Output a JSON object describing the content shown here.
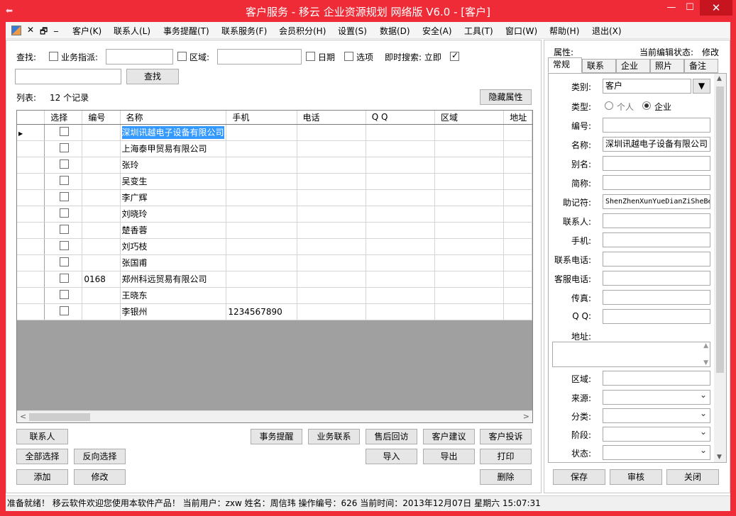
{
  "window": {
    "title": "客户服务 - 移云 企业资源规划 网络版 V6.0 - [客户]",
    "min_glyph": "—",
    "max_glyph": "☐",
    "close_glyph": "✕"
  },
  "menubar": {
    "items": [
      "客户(K)",
      "联系人(L)",
      "事务提醒(T)",
      "联系服务(F)",
      "会员积分(H)",
      "设置(S)",
      "数据(D)",
      "安全(A)",
      "工具(T)",
      "窗口(W)",
      "帮助(H)",
      "退出(X)"
    ],
    "mdi_close": "✕",
    "mdi_restore": "🗗",
    "mdi_min": "_"
  },
  "search": {
    "find_label": "查找:",
    "owner_label": "业务指派:",
    "region_label": "区域:",
    "date_label": "日期",
    "options_label": "选项",
    "instant_label": "即时搜索: 立即",
    "instant_checked": true,
    "find_button": "查找"
  },
  "list": {
    "label": "列表:",
    "count": "12 个记录",
    "hide_props_button": "隐藏属性"
  },
  "grid": {
    "columns": [
      "选择",
      "编号",
      "名称",
      "手机",
      "电话",
      "Q Q",
      "区域",
      "地址"
    ],
    "rows": [
      {
        "code": "",
        "name": "深圳讯越电子设备有限公司",
        "mobile": ""
      },
      {
        "code": "",
        "name": "上海泰甲贸易有限公司",
        "mobile": ""
      },
      {
        "code": "",
        "name": "张玲",
        "mobile": ""
      },
      {
        "code": "",
        "name": "吴变生",
        "mobile": ""
      },
      {
        "code": "",
        "name": "李广辉",
        "mobile": ""
      },
      {
        "code": "",
        "name": "刘晓玲",
        "mobile": ""
      },
      {
        "code": "",
        "name": "楚香蓉",
        "mobile": ""
      },
      {
        "code": "",
        "name": "刘巧枝",
        "mobile": ""
      },
      {
        "code": "",
        "name": "张国甫",
        "mobile": ""
      },
      {
        "code": "0168",
        "name": "郑州科远贸易有限公司",
        "mobile": ""
      },
      {
        "code": "",
        "name": "王晓东",
        "mobile": ""
      },
      {
        "code": "",
        "name": "李银州",
        "mobile": "1234567890"
      }
    ]
  },
  "buttons": {
    "contacts": "联系人",
    "reminder": "事务提醒",
    "biz_contact": "业务联系",
    "after_sales": "售后回访",
    "suggestion": "客户建议",
    "complaint": "客户投诉",
    "select_all": "全部选择",
    "invert_select": "反向选择",
    "import": "导入",
    "export": "导出",
    "print": "打印",
    "add": "添加",
    "edit": "修改",
    "delete": "删除"
  },
  "props": {
    "title": "属性:",
    "edit_state_label": "当前编辑状态:",
    "edit_state_value": "修改",
    "tabs": [
      "常规",
      "联系",
      "企业",
      "照片",
      "备注"
    ],
    "fields": {
      "category_label": "类别:",
      "category_value": "客户",
      "type_label": "类型:",
      "type_personal": "个人",
      "type_company": "企业",
      "code_label": "编号:",
      "name_label": "名称:",
      "name_value": "深圳讯越电子设备有限公司",
      "alias_label": "别名:",
      "short_label": "简称:",
      "mnemonic_label": "助记符:",
      "mnemonic_value": "ShenZhenXunYueDianZiSheBe",
      "contact_label": "联系人:",
      "mobile_label": "手机:",
      "phone_label": "联系电话:",
      "service_phone_label": "客服电话:",
      "fax_label": "传真:",
      "qq_label": "Q Q:",
      "address_label": "地址:",
      "region_label": "区域:",
      "source_label": "来源:",
      "class_label": "分类:",
      "stage_label": "阶段:",
      "status_label": "状态:"
    },
    "save_button": "保存",
    "review_button": "审核",
    "close_button": "关闭"
  },
  "statusbar": {
    "text": "准备就绪！  移云软件欢迎您使用本软件产品！  当前用户：zxw  姓名：周信玮  操作编号：626  当前时间：2013年12月07日 星期六 15:07:31"
  },
  "colors": {
    "title_bar": "#ee2b36",
    "selection": "#3399ff"
  }
}
